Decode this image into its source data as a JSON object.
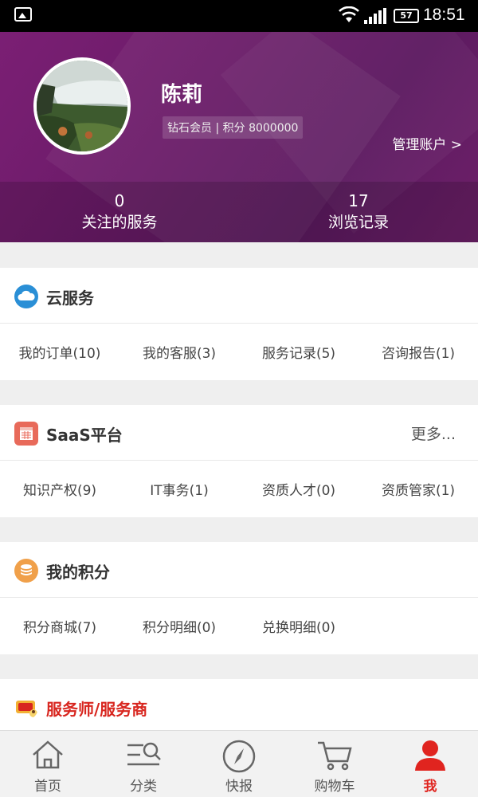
{
  "status_bar": {
    "battery": "57",
    "time": "18:51"
  },
  "profile": {
    "name": "陈莉",
    "meta": "钻石会员 | 积分 8000000",
    "manage_account": "管理账户 >",
    "stats": [
      {
        "value": "0",
        "label": "关注的服务"
      },
      {
        "value": "17",
        "label": "浏览记录"
      }
    ]
  },
  "sections": {
    "cloud": {
      "title": "云服务",
      "icon": "cloud-icon",
      "items": [
        "我的订单(10)",
        "我的客服(3)",
        "服务记录(5)",
        "咨询报告(1)"
      ]
    },
    "saas": {
      "title": "SaaS平台",
      "icon": "calendar-icon",
      "more": "更多...",
      "items": [
        "知识产权(9)",
        "IT事务(1)",
        "资质人才(0)",
        "资质管家(1)"
      ]
    },
    "points": {
      "title": "我的积分",
      "icon": "coin-stack-icon",
      "items": [
        "积分商城(7)",
        "积分明细(0)",
        "兑换明细(0)"
      ]
    },
    "servicers": {
      "title": "服务师/服务商",
      "icon": "servicer-icon"
    }
  },
  "bottom_nav": [
    {
      "label": "首页",
      "icon": "home-icon"
    },
    {
      "label": "分类",
      "icon": "category-search-icon"
    },
    {
      "label": "快报",
      "icon": "compass-icon"
    },
    {
      "label": "购物车",
      "icon": "cart-icon"
    },
    {
      "label": "我",
      "icon": "person-icon",
      "active": true
    }
  ],
  "colors": {
    "header": "#6a1b68",
    "accent": "#e0241f",
    "cloud": "#2a8fd6",
    "saas": "#e86a5a",
    "points": "#f0a04a"
  }
}
